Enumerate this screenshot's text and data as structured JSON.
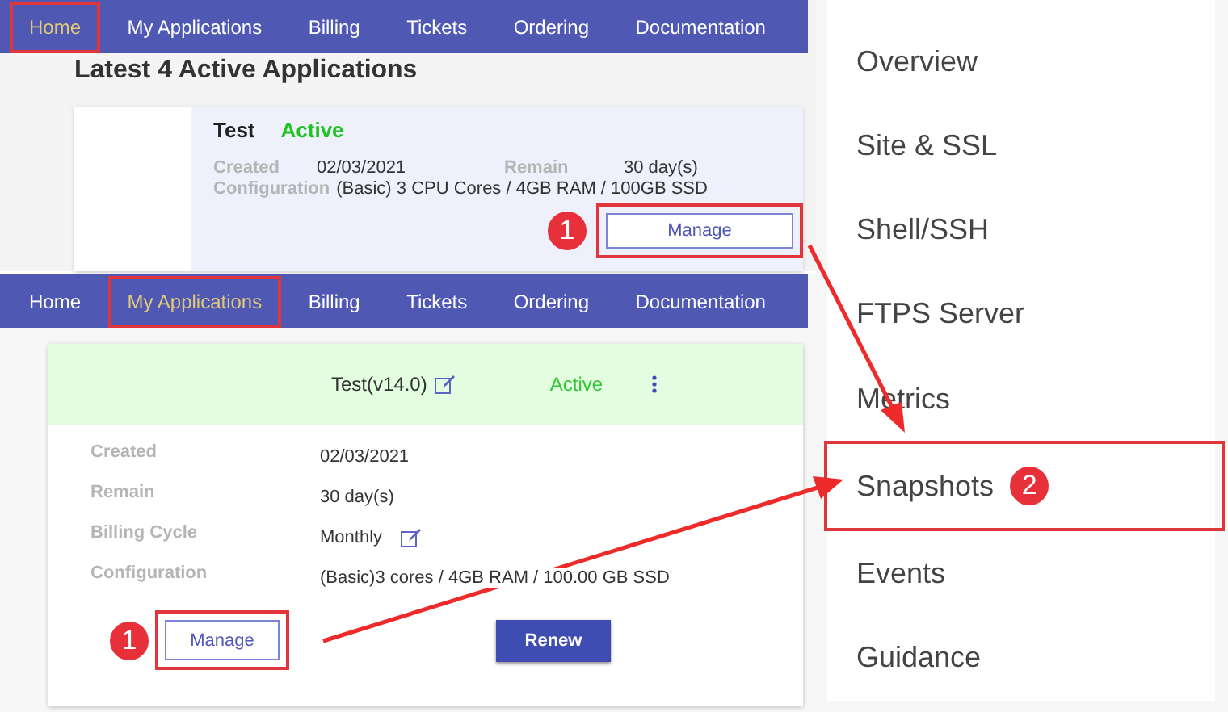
{
  "top_panel": {
    "nav": [
      {
        "label": "Home",
        "selected": true,
        "highlighted": true
      },
      {
        "label": "My Applications",
        "selected": false,
        "highlighted": false
      },
      {
        "label": "Billing",
        "selected": false,
        "highlighted": false
      },
      {
        "label": "Tickets",
        "selected": false,
        "highlighted": false
      },
      {
        "label": "Ordering",
        "selected": false,
        "highlighted": false
      },
      {
        "label": "Documentation",
        "selected": false,
        "highlighted": false
      }
    ],
    "heading": "Latest 4 Active Applications",
    "card": {
      "name": "Test",
      "status": "Active",
      "created_label": "Created",
      "created": "02/03/2021",
      "remain_label": "Remain",
      "remain": "30 day(s)",
      "config_label": "Configuration",
      "config": "(Basic) 3 CPU Cores / 4GB RAM / 100GB SSD",
      "button": "Manage",
      "callout": "1"
    }
  },
  "bottom_panel": {
    "nav": [
      {
        "label": "Home",
        "selected": false,
        "highlighted": false
      },
      {
        "label": "My Applications",
        "selected": true,
        "highlighted": true
      },
      {
        "label": "Billing",
        "selected": false,
        "highlighted": false
      },
      {
        "label": "Tickets",
        "selected": false,
        "highlighted": false
      },
      {
        "label": "Ordering",
        "selected": false,
        "highlighted": false
      },
      {
        "label": "Documentation",
        "selected": false,
        "highlighted": false
      }
    ],
    "card": {
      "title": "Test(v14.0)",
      "status": "Active",
      "fields": [
        {
          "label": "Created",
          "value": "02/03/2021",
          "editable": false
        },
        {
          "label": "Remain",
          "value": "30 day(s)",
          "editable": false
        },
        {
          "label": "Billing Cycle",
          "value": "Monthly",
          "editable": true
        },
        {
          "label": "Configuration",
          "value": "(Basic)3 cores / 4GB RAM / 100.00 GB SSD",
          "editable": false
        }
      ],
      "manage_button": "Manage",
      "renew_button": "Renew",
      "callout": "1"
    }
  },
  "side_menu": {
    "items": [
      {
        "label": "Overview",
        "highlighted": false
      },
      {
        "label": "Site & SSL",
        "highlighted": false
      },
      {
        "label": "Shell/SSH",
        "highlighted": false
      },
      {
        "label": "FTPS Server",
        "highlighted": false
      },
      {
        "label": "Metrics",
        "highlighted": false
      },
      {
        "label": "Snapshots",
        "highlighted": true,
        "callout": "2"
      },
      {
        "label": "Events",
        "highlighted": false
      },
      {
        "label": "Guidance",
        "highlighted": false
      }
    ]
  }
}
